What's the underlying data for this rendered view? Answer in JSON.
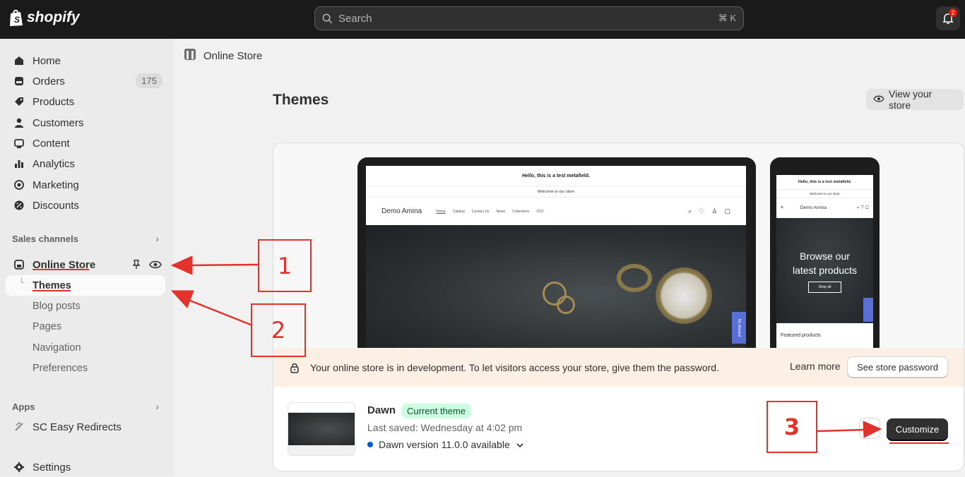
{
  "topbar": {
    "brand": "shopify",
    "search_placeholder": "Search",
    "search_shortcut": "⌘ K",
    "notification_count": "2"
  },
  "sidebar": {
    "items": [
      {
        "label": "Home",
        "icon": "home-icon"
      },
      {
        "label": "Orders",
        "icon": "orders-icon",
        "count": "175"
      },
      {
        "label": "Products",
        "icon": "tag-icon"
      },
      {
        "label": "Customers",
        "icon": "person-icon"
      },
      {
        "label": "Content",
        "icon": "content-icon"
      },
      {
        "label": "Analytics",
        "icon": "bar-chart-icon"
      },
      {
        "label": "Marketing",
        "icon": "target-icon"
      },
      {
        "label": "Discounts",
        "icon": "discount-icon"
      }
    ],
    "sales_channels_label": "Sales channels",
    "online_store_label": "Online Store",
    "sub_items": [
      "Themes",
      "Blog posts",
      "Pages",
      "Navigation",
      "Preferences"
    ],
    "apps_label": "Apps",
    "app_item": "SC Easy Redirects",
    "settings_label": "Settings"
  },
  "main": {
    "breadcrumb": "Online Store",
    "title": "Themes",
    "view_store_label": "View your store",
    "preview": {
      "announcement": "Hello, this is a test metafield.",
      "welcome": "Welcome to our store",
      "brand": "Demo Amina",
      "nav_links": [
        "Home",
        "Catalog",
        "Contact Us",
        "News",
        "Collections",
        "OST"
      ],
      "wishlist_tab": "My Wishlist",
      "mobile_hero_line1": "Browse our",
      "mobile_hero_line2": "latest products",
      "mobile_hero_button": "Shop all",
      "mobile_featured": "Featured products"
    },
    "banner": {
      "text": "Your online store is in development. To let visitors access your store, give them the password.",
      "learn_more": "Learn more",
      "button": "See store password"
    },
    "theme": {
      "name": "Dawn",
      "status": "Current theme",
      "saved": "Last saved: Wednesday at 4:02 pm",
      "version": "Dawn version 11.0.0 available",
      "customize": "Customize"
    }
  },
  "annotations": {
    "step1": "1",
    "step2": "2",
    "step3": "3",
    "color": "#e3312b"
  }
}
